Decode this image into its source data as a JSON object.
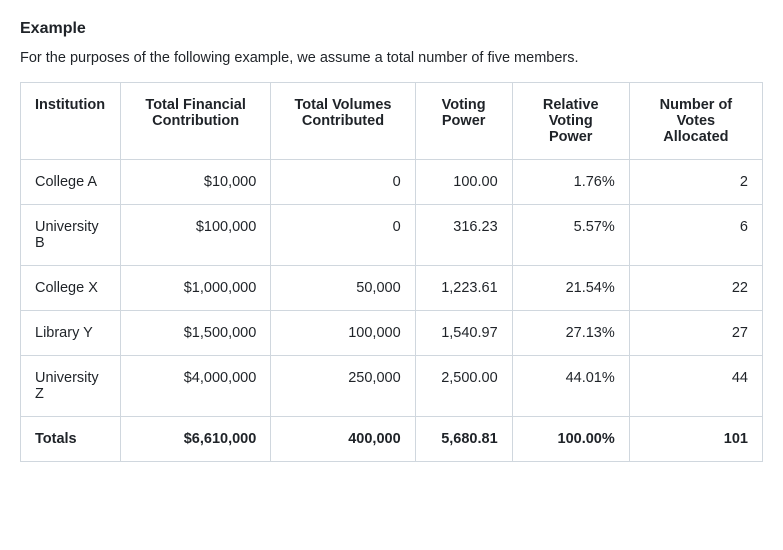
{
  "heading": "Example",
  "intro": "For the purposes of the following example, we assume a total number of five members.",
  "table": {
    "headers": {
      "institution": "Institution",
      "total_financial_contribution": "Total Financial Contribution",
      "total_volumes_contributed": "Total Volumes Contributed",
      "voting_power": "Voting Power",
      "relative_voting_power": "Relative Voting Power",
      "number_of_votes_allocated": "Number of Votes Allocated"
    },
    "rows": [
      {
        "institution": "College A",
        "tfc": "$10,000",
        "tvc": "0",
        "vp": "100.00",
        "rvp": "1.76%",
        "nva": "2"
      },
      {
        "institution": "University B",
        "tfc": "$100,000",
        "tvc": "0",
        "vp": "316.23",
        "rvp": "5.57%",
        "nva": "6"
      },
      {
        "institution": "College X",
        "tfc": "$1,000,000",
        "tvc": "50,000",
        "vp": "1,223.61",
        "rvp": "21.54%",
        "nva": "22"
      },
      {
        "institution": "Library Y",
        "tfc": "$1,500,000",
        "tvc": "100,000",
        "vp": "1,540.97",
        "rvp": "27.13%",
        "nva": "27"
      },
      {
        "institution": "University Z",
        "tfc": "$4,000,000",
        "tvc": "250,000",
        "vp": "2,500.00",
        "rvp": "44.01%",
        "nva": "44"
      }
    ],
    "totals": {
      "institution": "Totals",
      "tfc": "$6,610,000",
      "tvc": "400,000",
      "vp": "5,680.81",
      "rvp": "100.00%",
      "nva": "101"
    }
  }
}
